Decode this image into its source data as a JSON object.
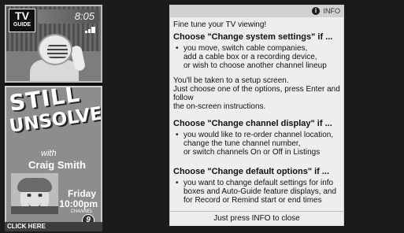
{
  "logo": {
    "line1": "TV",
    "line2": "GUIDE"
  },
  "clock": {
    "time": "8:05"
  },
  "promo": {
    "title_line1": "STILL",
    "title_line2": "UNSOLVED",
    "with_text": "with",
    "host": "Craig Smith",
    "day": "Friday",
    "time": "10:00pm",
    "channel_label": "CHANNEL",
    "channel_number": "9",
    "click_here": "CLICK HERE"
  },
  "panel": {
    "info_label": "INFO",
    "info_icon_glyph": "i",
    "intro": "Fine tune your TV viewing!",
    "section1": {
      "heading": "Choose \"Change system settings\" if ...",
      "bullets": [
        "you move, switch cable companies,",
        "add a cable box or a recording device,",
        "or wish to choose another channel lineup"
      ],
      "paragraph": [
        "You'll be taken to a setup screen.",
        "Just choose one of the options, press Enter and follow",
        "the on-screen instructions."
      ]
    },
    "section2": {
      "heading": "Choose \"Change channel display\" if ...",
      "bullets": [
        "you would like to re-order channel location,",
        "change the tune channel number,",
        "or switch channels On or Off in Listings"
      ]
    },
    "section3": {
      "heading": "Choose \"Change default options\" if ...",
      "bullets": [
        "you want to change default settings for info",
        "boxes and Auto-Guide feature displays, and",
        "for Record or Remind start or end times"
      ]
    },
    "footer": "Just press INFO to close"
  }
}
